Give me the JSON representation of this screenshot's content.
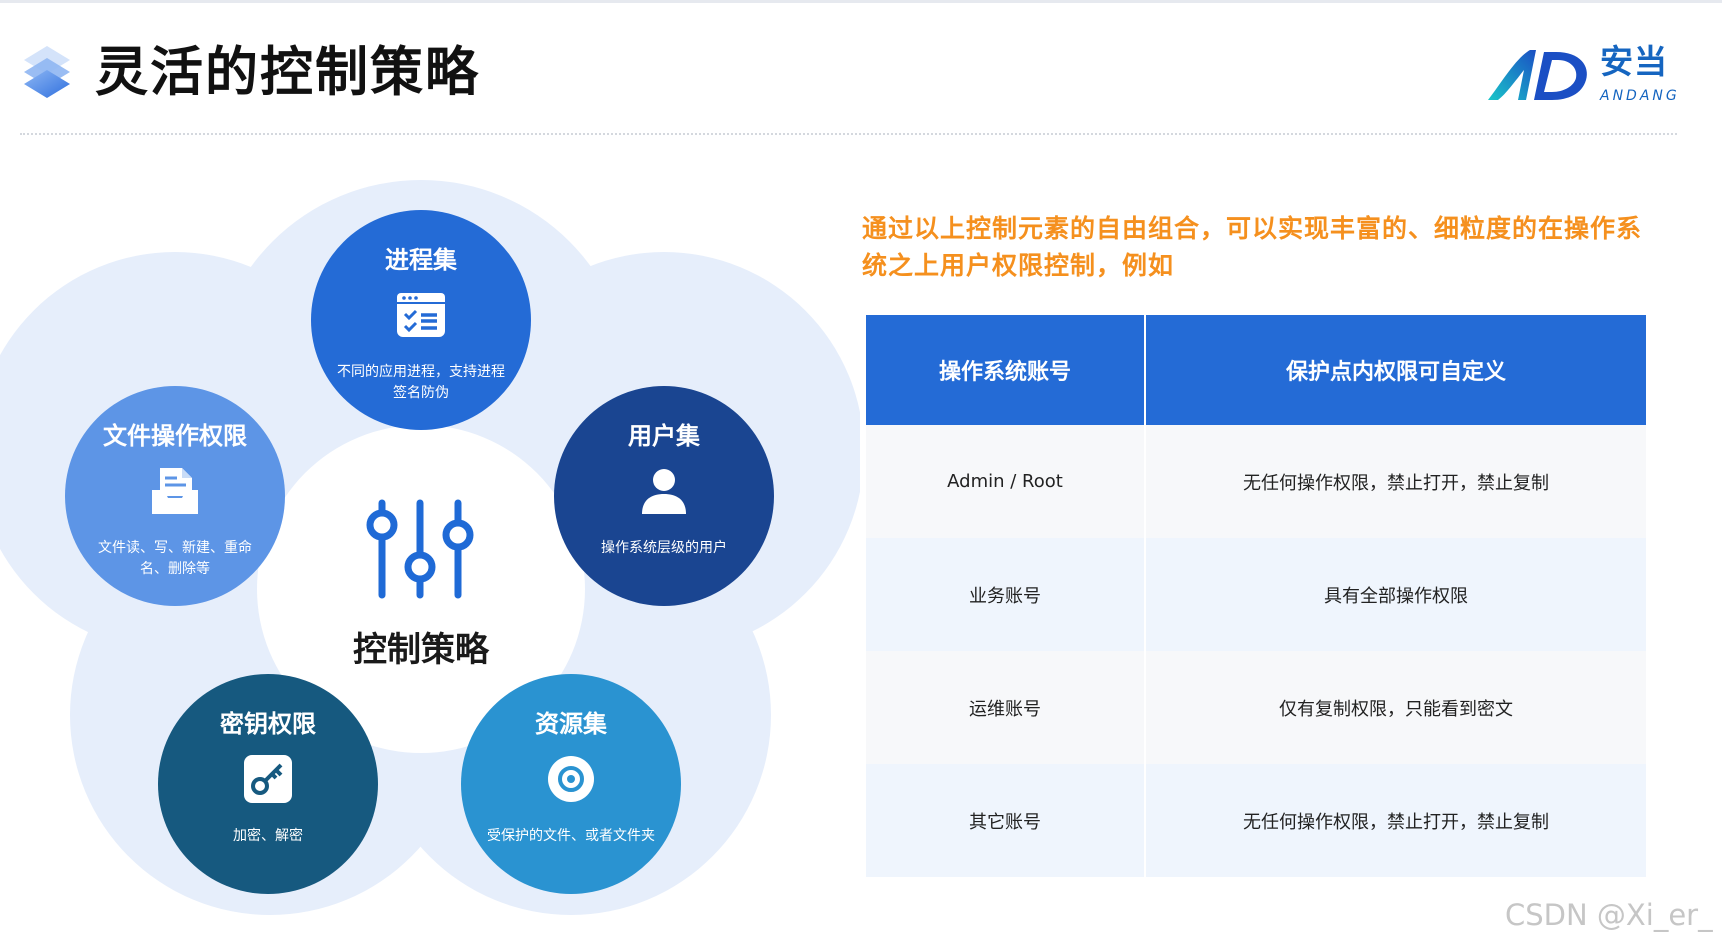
{
  "header": {
    "title": "灵活的控制策略",
    "logo_cn": "安当",
    "logo_en": "ANDANG"
  },
  "diagram": {
    "center_label": "控制策略",
    "nodes": [
      {
        "title": "进程集",
        "desc": "不同的应用进程，支持进程签名防伪",
        "icon": "browser-window-checklist-icon",
        "color": "#246bd6"
      },
      {
        "title": "用户集",
        "desc": "操作系统层级的用户",
        "icon": "user-icon",
        "color": "#1a4591"
      },
      {
        "title": "资源集",
        "desc": "受保护的文件、或者文件夹",
        "icon": "disc-icon",
        "color": "#2a93d1"
      },
      {
        "title": "密钥权限",
        "desc": "加密、解密",
        "icon": "key-icon",
        "color": "#16597f"
      },
      {
        "title": "文件操作权限",
        "desc": "文件读、写、新建、重命名、删除等",
        "icon": "file-document-icon",
        "color": "#5d95e6"
      }
    ]
  },
  "headline": "通过以上控制元素的自由组合，可以实现丰富的、细粒度的在操作系统之上用户权限控制，例如",
  "table": {
    "headers": [
      "操作系统账号",
      "保护点内权限可自定义"
    ],
    "rows": [
      [
        "Admin / Root",
        "无任何操作权限，禁止打开，禁止复制"
      ],
      [
        "业务账号",
        "具有全部操作权限"
      ],
      [
        "运维账号",
        "仅有复制权限，只能看到密文"
      ],
      [
        "其它账号",
        "无任何操作权限，禁止打开，禁止复制"
      ]
    ]
  },
  "colors": {
    "accent_blue": "#246bd6",
    "headline_orange": "#f5901e"
  },
  "watermark": "CSDN @Xi_er_"
}
